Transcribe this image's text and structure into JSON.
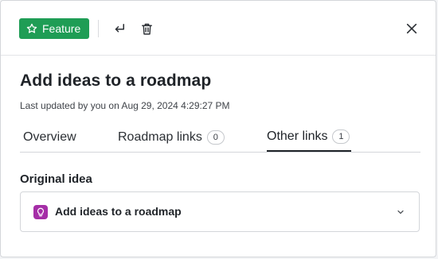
{
  "toolbar": {
    "feature_label": "Feature",
    "feature_icon": "star-outline-icon",
    "feature_color": "#1f9d55",
    "return_icon": "return-arrow-icon",
    "trash_icon": "trash-icon",
    "close_icon": "close-icon"
  },
  "record": {
    "title": "Add ideas to a roadmap",
    "last_updated": "Last updated by you on Aug 29, 2024 4:29:27 PM"
  },
  "tabs": [
    {
      "label": "Overview",
      "count": null,
      "active": false
    },
    {
      "label": "Roadmap links",
      "count": "0",
      "active": false
    },
    {
      "label": "Other links",
      "count": "1",
      "active": true
    }
  ],
  "original_idea": {
    "section_label": "Original idea",
    "name": "Add ideas to a roadmap",
    "icon": "lightbulb-icon",
    "icon_color": "#a52ea7",
    "expand_icon": "chevron-down-icon"
  }
}
